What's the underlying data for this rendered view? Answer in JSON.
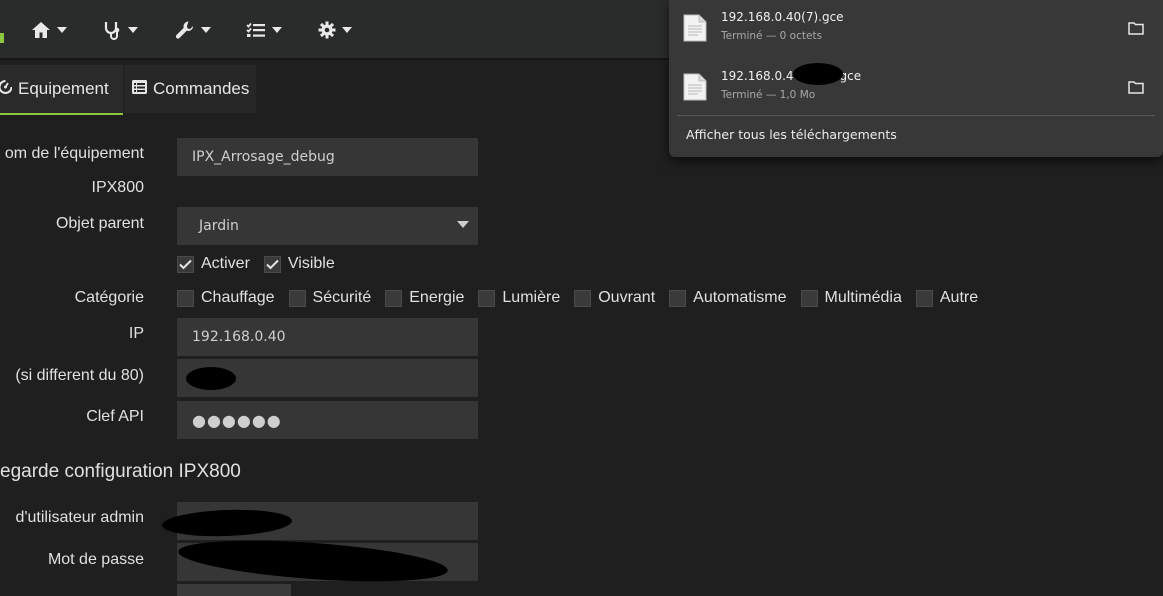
{
  "nav": {
    "items": [
      {
        "icon": "home-icon"
      },
      {
        "icon": "stethoscope-icon"
      },
      {
        "icon": "wrench-icon"
      },
      {
        "icon": "tasks-icon"
      },
      {
        "icon": "gear-icon"
      }
    ]
  },
  "tabs": [
    {
      "label": "Equipement",
      "icon": "dashboard-icon"
    },
    {
      "label": "Commandes",
      "icon": "list-icon"
    }
  ],
  "form": {
    "name_label": "om de l'équipement",
    "name_value": "IPX_Arrosage_debug",
    "type_label": "IPX800",
    "parent_label": "Objet parent",
    "parent_value": "Jardin",
    "activer_label": "Activer",
    "visible_label": "Visible",
    "category_label": "Catégorie",
    "categories": [
      "Chauffage",
      "Sécurité",
      "Energie",
      "Lumière",
      "Ouvrant",
      "Automatisme",
      "Multimédia",
      "Autre"
    ],
    "ip_label": "IP",
    "ip_value": "192.168.0.40",
    "port_label": "(si different du 80)",
    "api_label": "Clef API",
    "api_value": "●●●●●●",
    "backup_title": "egarde configuration IPX800",
    "admin_label": "d'utilisateur admin",
    "password_label": "Mot de passe"
  },
  "downloads": {
    "items": [
      {
        "name": "192.168.0.40(7).gce",
        "status": "Terminé — 0 octets"
      },
      {
        "name": "192.168.0.4",
        "name_suffix": "gce",
        "status": "Terminé — 1,0 Mo"
      }
    ],
    "show_all": "Afficher tous les téléchargements"
  }
}
